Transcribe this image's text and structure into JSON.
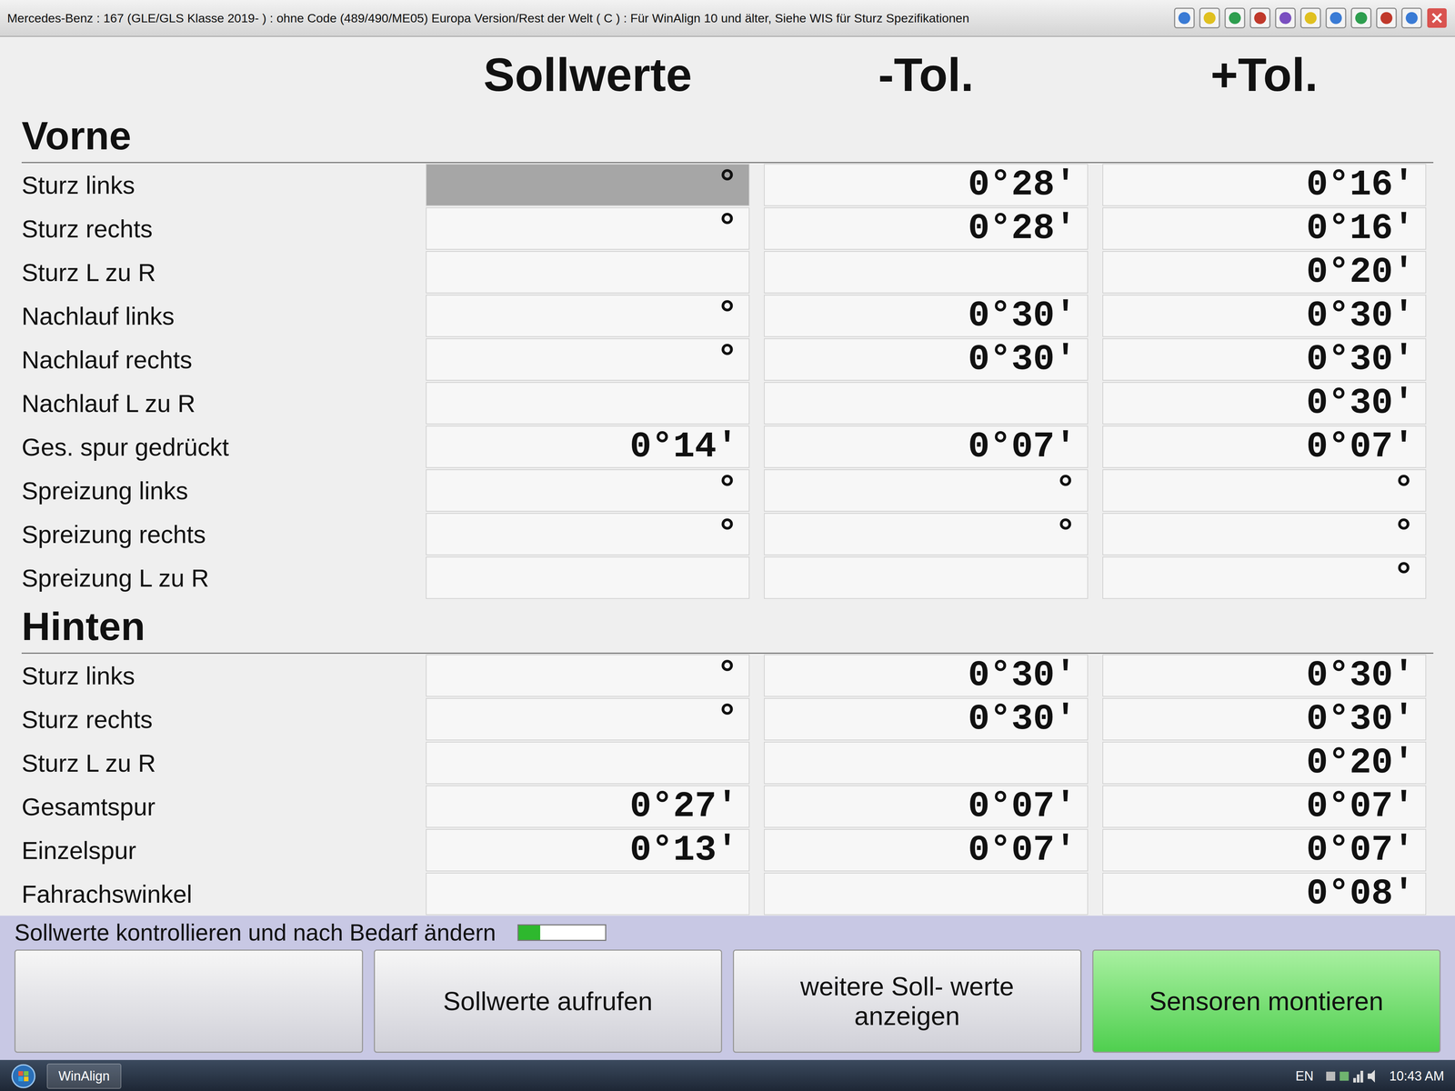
{
  "window": {
    "title": "Mercedes-Benz : 167 (GLE/GLS Klasse 2019- ) : ohne Code (489/490/ME05) Europa Version/Rest der Welt ( C ) : Für WinAlign 10 und älter, Siehe WIS für Sturz Spezifikationen"
  },
  "columns": [
    "Sollwerte",
    "-Tol.",
    "+Tol."
  ],
  "sections": [
    {
      "title": "Vorne",
      "rows": [
        {
          "label": "Sturz links",
          "selected": true,
          "cells": [
            "°",
            "0°28'",
            "0°16'"
          ]
        },
        {
          "label": "Sturz rechts",
          "selected": false,
          "cells": [
            "°",
            "0°28'",
            "0°16'"
          ]
        },
        {
          "label": "Sturz  L zu R",
          "selected": false,
          "cells": [
            "",
            "",
            "0°20'"
          ]
        },
        {
          "label": "Nachlauf links",
          "selected": false,
          "cells": [
            "°",
            "0°30'",
            "0°30'"
          ]
        },
        {
          "label": "Nachlauf rechts",
          "selected": false,
          "cells": [
            "°",
            "0°30'",
            "0°30'"
          ]
        },
        {
          "label": "Nachlauf  L zu R",
          "selected": false,
          "cells": [
            "",
            "",
            "0°30'"
          ]
        },
        {
          "label": "Ges. spur gedrückt",
          "selected": false,
          "cells": [
            "0°14'",
            "0°07'",
            "0°07'"
          ]
        },
        {
          "label": "Spreizung links",
          "selected": false,
          "cells": [
            "°",
            "°",
            "°"
          ]
        },
        {
          "label": "Spreizung rechts",
          "selected": false,
          "cells": [
            "°",
            "°",
            "°"
          ]
        },
        {
          "label": "Spreizung L zu R",
          "selected": false,
          "cells": [
            "",
            "",
            "°"
          ]
        }
      ]
    },
    {
      "title": "Hinten",
      "rows": [
        {
          "label": "Sturz links",
          "selected": false,
          "cells": [
            "°",
            "0°30'",
            "0°30'"
          ]
        },
        {
          "label": "Sturz rechts",
          "selected": false,
          "cells": [
            "°",
            "0°30'",
            "0°30'"
          ]
        },
        {
          "label": "Sturz  L zu R",
          "selected": false,
          "cells": [
            "",
            "",
            "0°20'"
          ]
        },
        {
          "label": "Gesamtspur",
          "selected": false,
          "cells": [
            "0°27'",
            "0°07'",
            "0°07'"
          ]
        },
        {
          "label": "Einzelspur",
          "selected": false,
          "cells": [
            "0°13'",
            "0°07'",
            "0°07'"
          ]
        },
        {
          "label": "Fahrachswinkel",
          "selected": false,
          "cells": [
            "",
            "",
            "0°08'"
          ]
        }
      ]
    }
  ],
  "prompt": "Sollwerte kontrollieren und nach Bedarf ändern",
  "progress": {
    "level": 0.25
  },
  "buttons": [
    {
      "label": "",
      "primary": false
    },
    {
      "label": "Sollwerte aufrufen",
      "primary": false
    },
    {
      "label": "weitere Soll- werte anzeigen",
      "primary": false
    },
    {
      "label": "Sensoren montieren",
      "primary": true
    }
  ],
  "taskbar": {
    "task": "WinAlign",
    "language": "EN",
    "time": "10:43 AM"
  }
}
